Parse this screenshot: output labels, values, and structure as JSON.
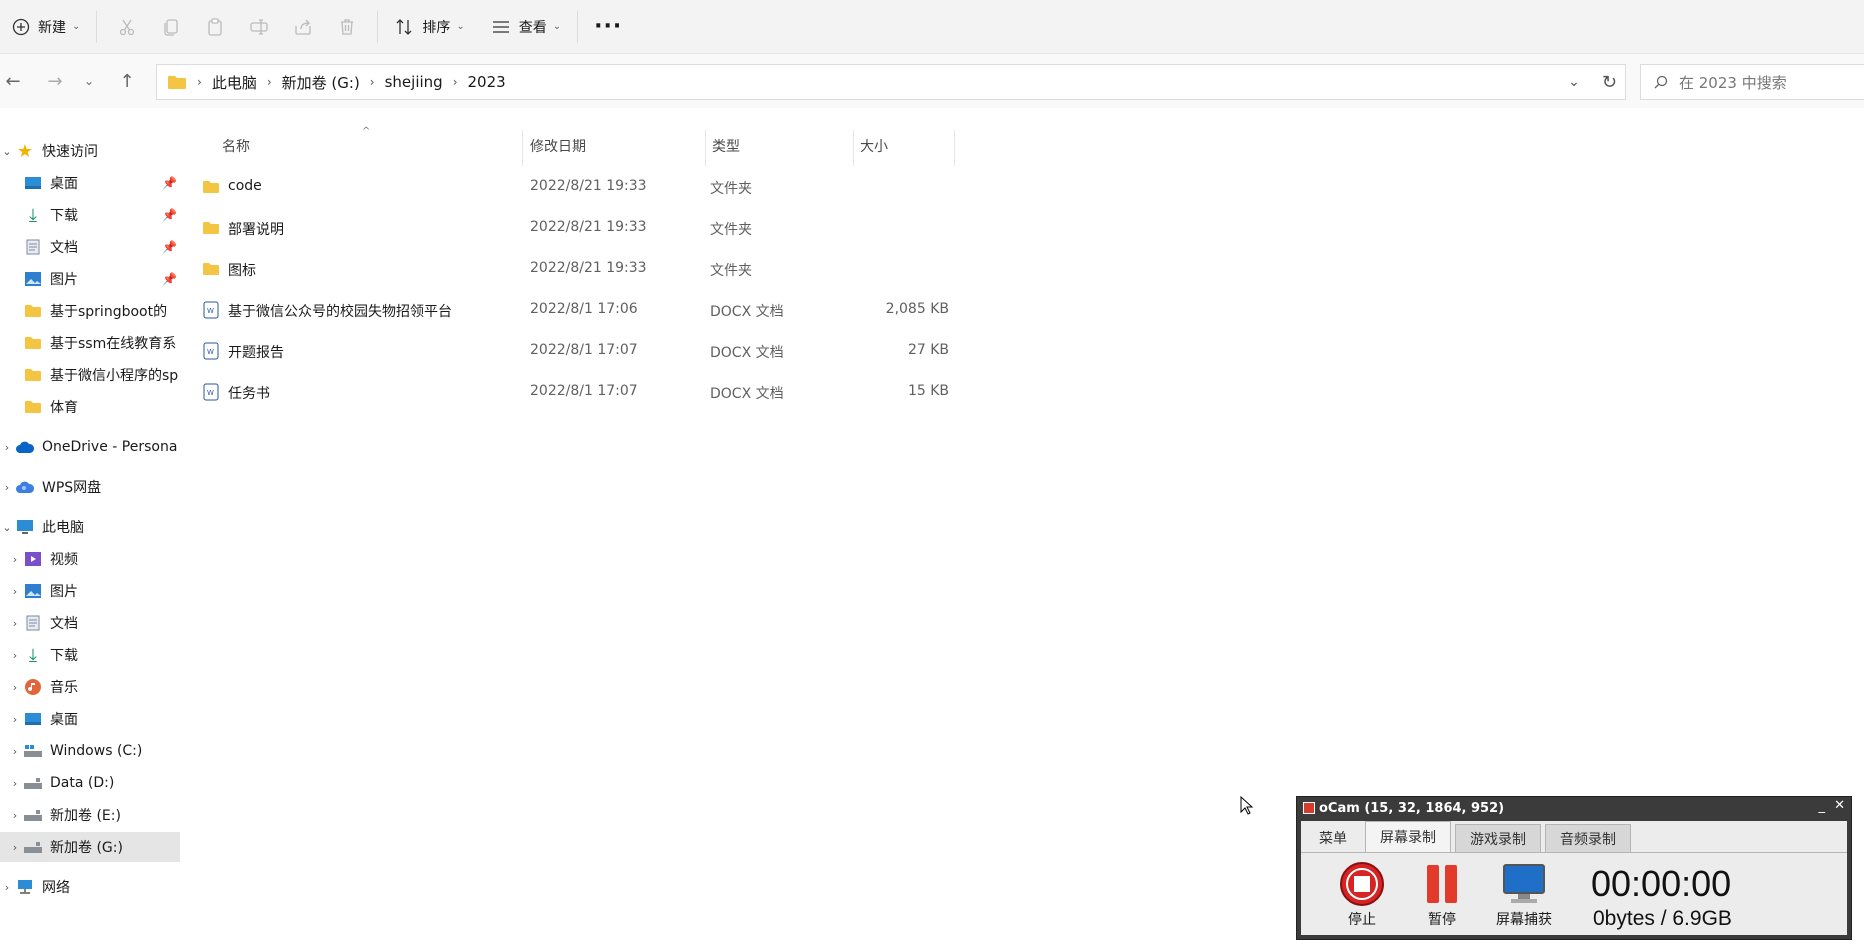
{
  "toolbar": {
    "new_label": "新建",
    "sort_label": "排序",
    "view_label": "查看"
  },
  "address": {
    "crumbs": [
      "此电脑",
      "新加卷 (G:)",
      "shejiing",
      "2023"
    ],
    "search_placeholder": "在 2023 中搜索"
  },
  "sidebar": {
    "quick_access": "快速访问",
    "items": [
      {
        "label": "桌面",
        "icon": "desktop-icon",
        "pinned": true
      },
      {
        "label": "下载",
        "icon": "download-icon",
        "pinned": true
      },
      {
        "label": "文档",
        "icon": "document-icon",
        "pinned": true
      },
      {
        "label": "图片",
        "icon": "pictures-icon",
        "pinned": true
      },
      {
        "label": "基于springboot的",
        "icon": "folder-icon"
      },
      {
        "label": "基于ssm在线教育系",
        "icon": "folder-icon"
      },
      {
        "label": "基于微信小程序的sp",
        "icon": "folder-icon"
      },
      {
        "label": "体育",
        "icon": "folder-icon"
      }
    ],
    "onedrive": "OneDrive - Persona",
    "wps": "WPS网盘",
    "this_pc": "此电脑",
    "pc_items": [
      {
        "label": "视频",
        "icon": "video-icon"
      },
      {
        "label": "图片",
        "icon": "pictures-icon"
      },
      {
        "label": "文档",
        "icon": "document-icon"
      },
      {
        "label": "下载",
        "icon": "download-icon"
      },
      {
        "label": "音乐",
        "icon": "music-icon"
      },
      {
        "label": "桌面",
        "icon": "desktop-icon"
      },
      {
        "label": "Windows (C:)",
        "icon": "drive-icon"
      },
      {
        "label": "Data (D:)",
        "icon": "drive-icon"
      },
      {
        "label": "新加卷 (E:)",
        "icon": "drive-icon"
      },
      {
        "label": "新加卷 (G:)",
        "icon": "drive-icon",
        "selected": true
      }
    ],
    "network": "网络"
  },
  "columns": {
    "name": "名称",
    "modified": "修改日期",
    "type": "类型",
    "size": "大小"
  },
  "files": [
    {
      "name": "code",
      "modified": "2022/8/21 19:33",
      "type": "文件夹",
      "size": "",
      "icon": "folder-icon"
    },
    {
      "name": "部署说明",
      "modified": "2022/8/21 19:33",
      "type": "文件夹",
      "size": "",
      "icon": "folder-icon"
    },
    {
      "name": "图标",
      "modified": "2022/8/21 19:33",
      "type": "文件夹",
      "size": "",
      "icon": "folder-icon"
    },
    {
      "name": "基于微信公众号的校园失物招领平台",
      "modified": "2022/8/1 17:06",
      "type": "DOCX 文档",
      "size": "2,085 KB",
      "icon": "docx-icon"
    },
    {
      "name": "开题报告",
      "modified": "2022/8/1 17:07",
      "type": "DOCX 文档",
      "size": "27 KB",
      "icon": "docx-icon"
    },
    {
      "name": "任务书",
      "modified": "2022/8/1 17:07",
      "type": "DOCX 文档",
      "size": "15 KB",
      "icon": "docx-icon"
    }
  ],
  "ocam": {
    "title": "oCam (15, 32, 1864, 952)",
    "tabs": [
      "菜单",
      "屏幕录制",
      "游戏录制",
      "音频录制"
    ],
    "stop_label": "停止",
    "pause_label": "暂停",
    "capture_label": "屏幕捕获",
    "time": "00:00:00",
    "size": "0bytes / 6.9GB"
  },
  "colors": {
    "folder": "#f4c542",
    "accent": "#0067c0",
    "docx": "#2b579a"
  }
}
